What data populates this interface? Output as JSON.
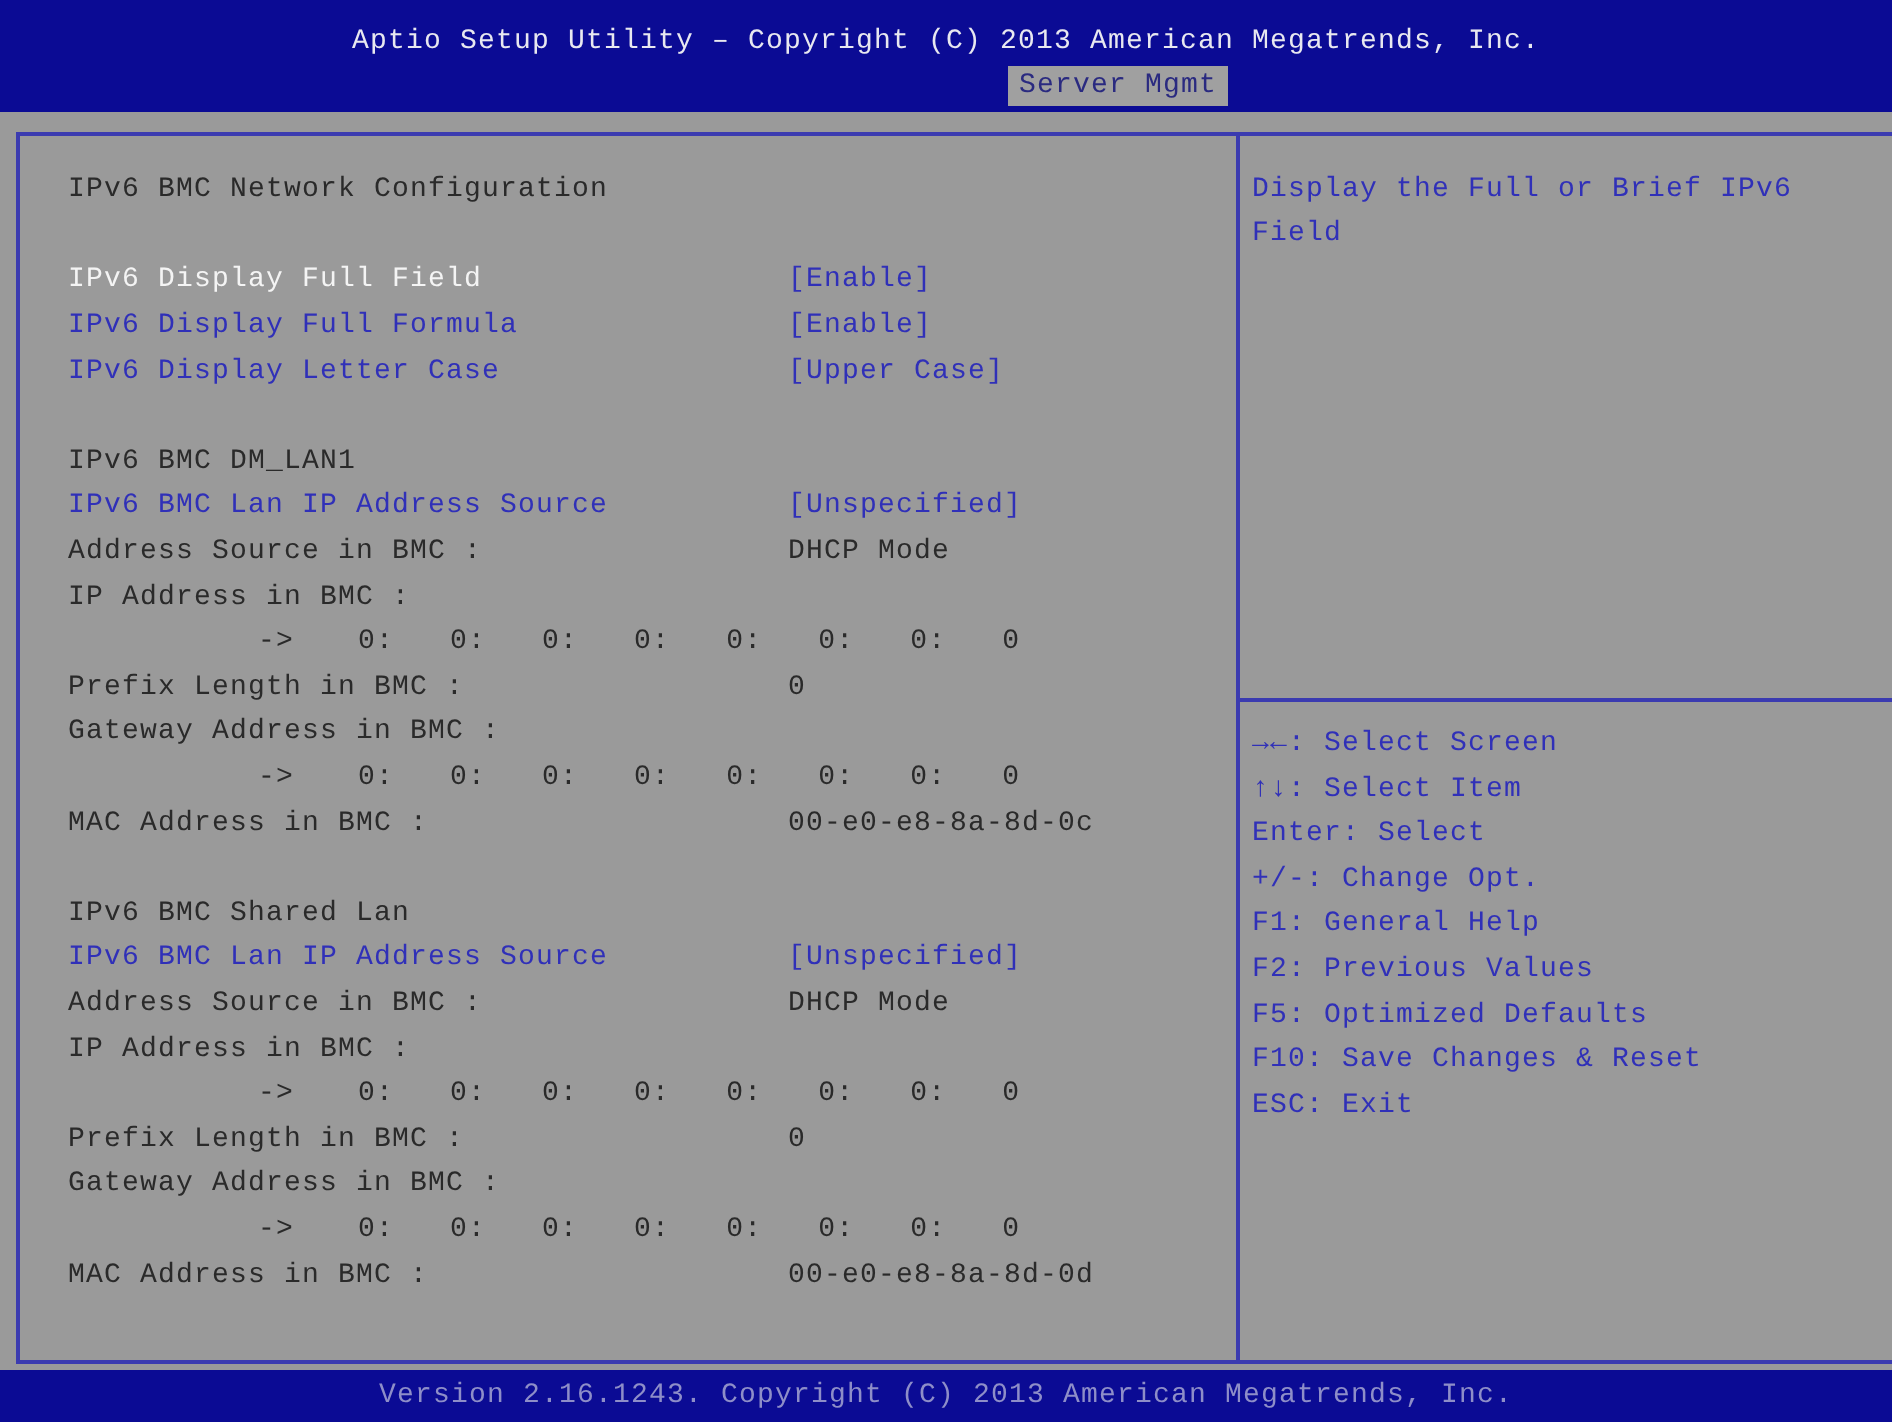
{
  "header": {
    "title": "Aptio Setup Utility – Copyright (C) 2013 American Megatrends, Inc.",
    "tabs": [
      {
        "label": "Server Mgmt",
        "selected": true
      }
    ]
  },
  "rows": [
    {
      "kind": "title",
      "text": "IPv6 BMC Network Configuration"
    },
    {
      "kind": "gap"
    },
    {
      "kind": "setting",
      "label": "IPv6 Display Full Field",
      "value": "[Enable]",
      "selected": true
    },
    {
      "kind": "setting",
      "label": "IPv6 Display Full Formula",
      "value": "[Enable]",
      "selected": false
    },
    {
      "kind": "setting",
      "label": "IPv6 Display Letter Case",
      "value": "[Upper Case]",
      "selected": false
    },
    {
      "kind": "gap"
    },
    {
      "kind": "title",
      "text": "IPv6 BMC DM_LAN1"
    },
    {
      "kind": "setting",
      "label": "IPv6 BMC Lan IP Address Source",
      "value": "[Unspecified]",
      "selected": false
    },
    {
      "kind": "info",
      "label": "Address Source in BMC :",
      "value": "DHCP Mode"
    },
    {
      "kind": "info",
      "label": "IP Address in BMC :"
    },
    {
      "kind": "address",
      "arrow": "->",
      "parts": [
        "0:",
        "0:",
        "0:",
        "0:",
        "0:",
        "0:",
        "0:",
        "0"
      ]
    },
    {
      "kind": "info",
      "label": "Prefix Length in BMC :",
      "value": "0"
    },
    {
      "kind": "info",
      "label": "Gateway Address in BMC :"
    },
    {
      "kind": "address",
      "arrow": "->",
      "parts": [
        "0:",
        "0:",
        "0:",
        "0:",
        "0:",
        "0:",
        "0:",
        "0"
      ]
    },
    {
      "kind": "info",
      "label": "MAC Address in BMC :",
      "value": "00-e0-e8-8a-8d-0c"
    },
    {
      "kind": "gap"
    },
    {
      "kind": "title",
      "text": "IPv6 BMC Shared Lan"
    },
    {
      "kind": "setting",
      "label": "IPv6 BMC Lan IP Address Source",
      "value": "[Unspecified]",
      "selected": false
    },
    {
      "kind": "info",
      "label": "Address Source in BMC :",
      "value": "DHCP Mode"
    },
    {
      "kind": "info",
      "label": "IP Address in BMC :"
    },
    {
      "kind": "address",
      "arrow": "->",
      "parts": [
        "0:",
        "0:",
        "0:",
        "0:",
        "0:",
        "0:",
        "0:",
        "0"
      ]
    },
    {
      "kind": "info",
      "label": "Prefix Length in BMC :",
      "value": "0"
    },
    {
      "kind": "info",
      "label": "Gateway Address in BMC :"
    },
    {
      "kind": "address",
      "arrow": "->",
      "parts": [
        "0:",
        "0:",
        "0:",
        "0:",
        "0:",
        "0:",
        "0:",
        "0"
      ]
    },
    {
      "kind": "info",
      "label": "MAC Address in BMC :",
      "value": "00-e0-e8-8a-8d-0d"
    }
  ],
  "help": "Display the Full or Brief IPv6 Field",
  "keys": [
    "→←: Select Screen",
    "↑↓: Select Item",
    "Enter: Select",
    "+/-: Change Opt.",
    "F1: General Help",
    "F2: Previous Values",
    "F5: Optimized Defaults",
    "F10: Save Changes & Reset",
    "ESC: Exit"
  ],
  "footer": "Version 2.16.1243. Copyright (C) 2013 American Megatrends, Inc."
}
